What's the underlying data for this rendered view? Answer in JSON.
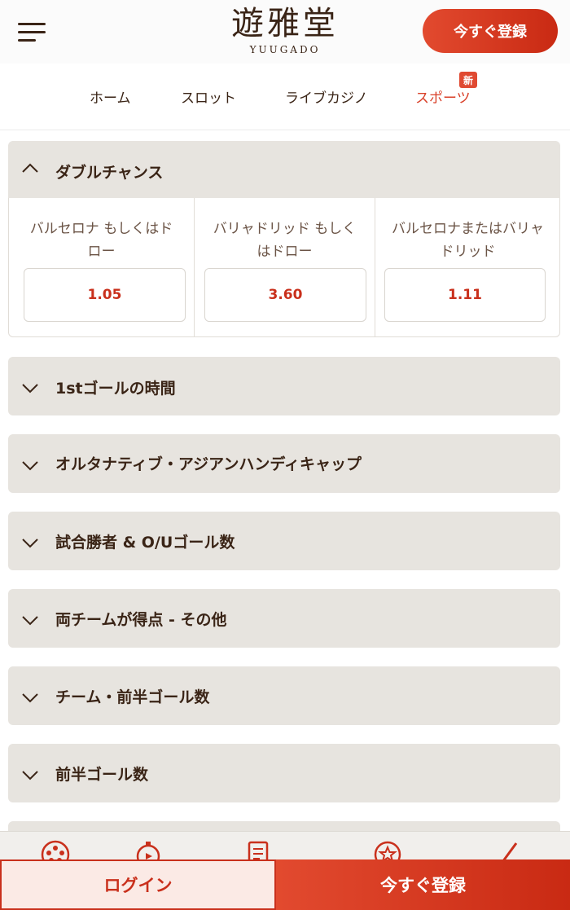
{
  "header": {
    "logo_kanji": "遊雅堂",
    "logo_latin": "YUUGADO",
    "register_label": "今すぐ登録"
  },
  "nav": {
    "items": [
      {
        "label": "ホーム"
      },
      {
        "label": "スロット"
      },
      {
        "label": "ライブカジノ"
      },
      {
        "label": "スポーツ",
        "active": true
      }
    ],
    "badge": "新"
  },
  "markets": {
    "open": {
      "title": "ダブルチャンス",
      "options": [
        {
          "label": "バルセロナ もしくはドロー",
          "odds": "1.05"
        },
        {
          "label": "バリャドリッド もしくはドロー",
          "odds": "3.60"
        },
        {
          "label": "バルセロナまたはバリャドリッド",
          "odds": "1.11"
        }
      ]
    },
    "collapsed": [
      "1stゴールの時間",
      "オルタナティブ・アジアンハンディキャップ",
      "試合勝者 & O/Uゴール数",
      "両チームが得点 - その他",
      "チーム・前半ゴール数",
      "前半ゴール数"
    ]
  },
  "footer": {
    "login_label": "ログイン",
    "register_label": "今すぐ登録",
    "icons": [
      "roulette-icon",
      "stopwatch-icon",
      "document-icon",
      "star-icon",
      "check-icon"
    ]
  },
  "colors": {
    "accent": "#d9412a",
    "text": "#3a2416",
    "panel": "#e7e4df"
  }
}
